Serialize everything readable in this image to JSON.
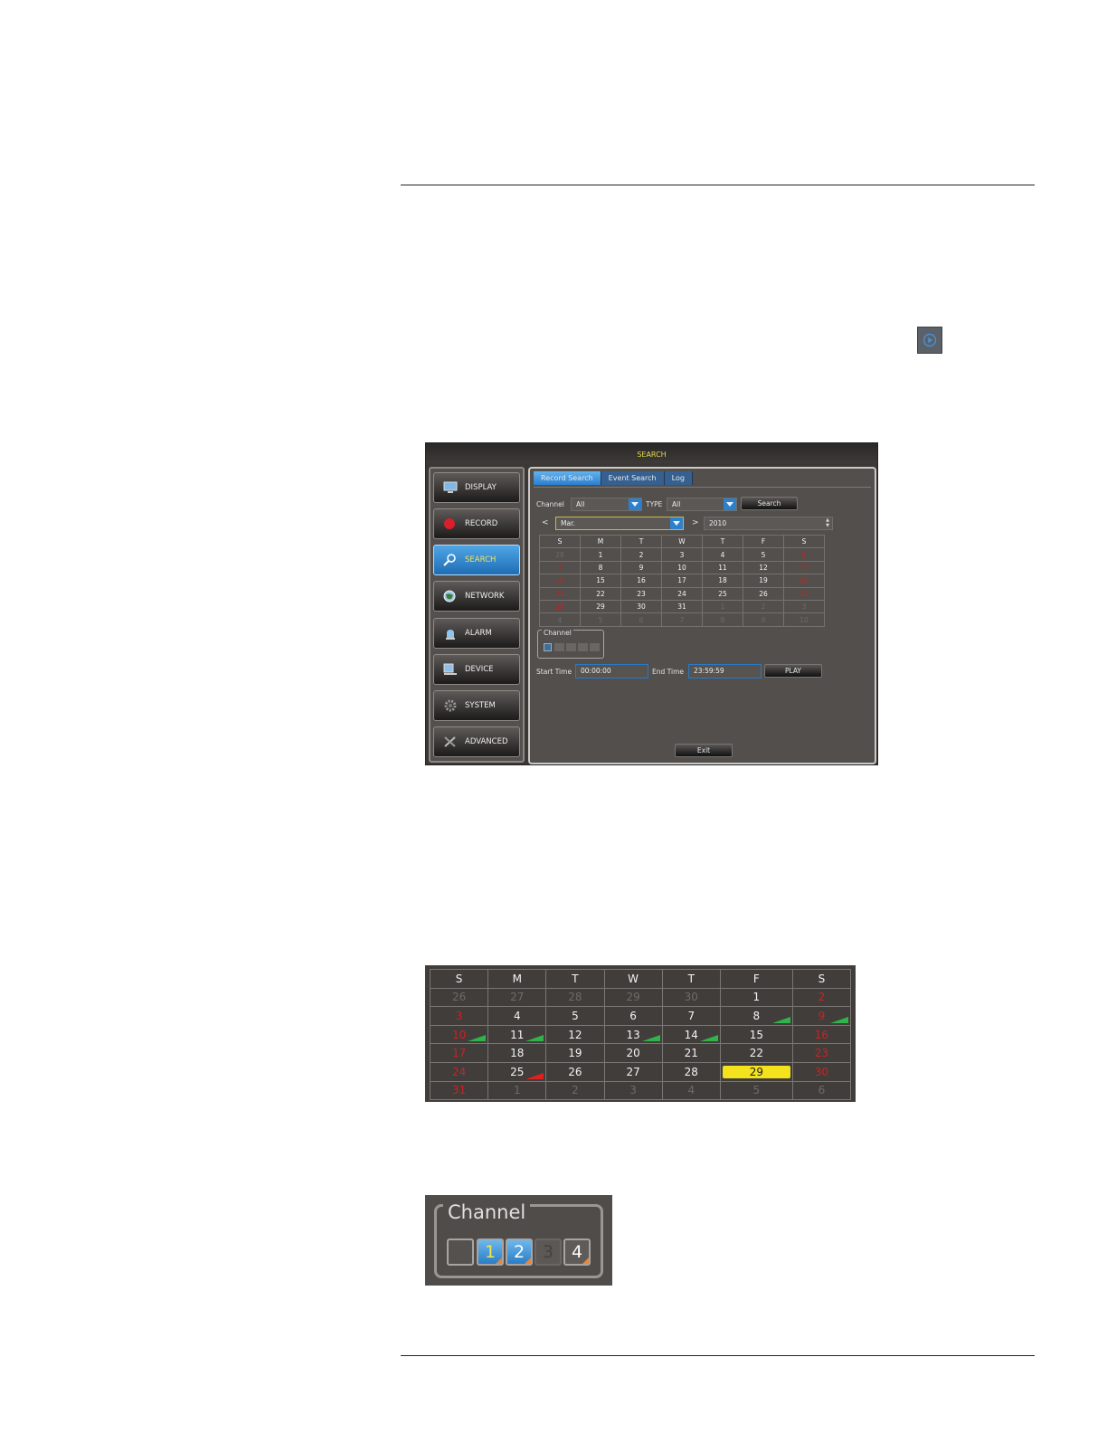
{
  "search_window": {
    "title": "SEARCH",
    "sidebar": [
      {
        "label": "DISPLAY",
        "icon": "monitor-icon"
      },
      {
        "label": "RECORD",
        "icon": "record-icon"
      },
      {
        "label": "SEARCH",
        "icon": "search-icon",
        "active": true
      },
      {
        "label": "NETWORK",
        "icon": "globe-icon"
      },
      {
        "label": "ALARM",
        "icon": "alarm-icon"
      },
      {
        "label": "DEVICE",
        "icon": "device-icon"
      },
      {
        "label": "SYSTEM",
        "icon": "gear-icon"
      },
      {
        "label": "ADVANCED",
        "icon": "tools-icon"
      }
    ],
    "tabs": [
      "Record Search",
      "Event Search",
      "Log"
    ],
    "channel_label": "Channel",
    "channel_value": "All",
    "type_label": "TYPE",
    "type_value": "All",
    "search_button": "Search",
    "month_prev": "<",
    "month_value": "Mar.",
    "month_next": ">",
    "year_value": "2010",
    "calendar": {
      "headers": [
        "S",
        "M",
        "T",
        "W",
        "T",
        "F",
        "S"
      ],
      "rows": [
        [
          "28",
          "1",
          "2",
          "3",
          "4",
          "5",
          "6"
        ],
        [
          "7",
          "8",
          "9",
          "10",
          "11",
          "12",
          "13"
        ],
        [
          "14",
          "15",
          "16",
          "17",
          "18",
          "19",
          "20"
        ],
        [
          "21",
          "22",
          "23",
          "24",
          "25",
          "26",
          "27"
        ],
        [
          "28",
          "29",
          "30",
          "31",
          "1",
          "2",
          "3"
        ],
        [
          "4",
          "5",
          "6",
          "7",
          "8",
          "9",
          "10"
        ]
      ]
    },
    "channel_group_label": "Channel",
    "start_time_label": "Start Time",
    "start_time_value": "00:00:00",
    "end_time_label": "End Time",
    "end_time_value": "23:59:59",
    "play_button": "PLAY",
    "exit_button": "Exit"
  },
  "enlarged_calendar": {
    "headers": [
      "S",
      "M",
      "T",
      "W",
      "T",
      "F",
      "S"
    ],
    "rows": [
      [
        "26",
        "27",
        "28",
        "29",
        "30",
        "1",
        "2"
      ],
      [
        "3",
        "4",
        "5",
        "6",
        "7",
        "8",
        "9"
      ],
      [
        "10",
        "11",
        "12",
        "13",
        "14",
        "15",
        "16"
      ],
      [
        "17",
        "18",
        "19",
        "20",
        "21",
        "22",
        "23"
      ],
      [
        "24",
        "25",
        "26",
        "27",
        "28",
        "29",
        "30"
      ],
      [
        "31",
        "1",
        "2",
        "3",
        "4",
        "5",
        "6"
      ]
    ],
    "selected_day": "29",
    "record_colors": {
      "normal": "#2fb34a",
      "alarm": "#e02020",
      "selected": "#f3e21c"
    }
  },
  "channel_panel": {
    "title": "Channel",
    "channels": [
      "1",
      "2",
      "3",
      "4"
    ]
  }
}
